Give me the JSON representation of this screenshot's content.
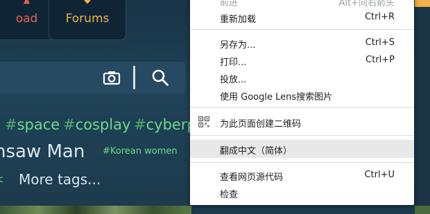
{
  "tiles": [
    {
      "label": "oad",
      "color": "#e85f57"
    },
    {
      "label": "Forums",
      "color": "#f0b04a"
    }
  ],
  "tags_row1": [
    {
      "hash": "#",
      "text": "space"
    },
    {
      "hash": "#",
      "text": "cosplay"
    },
    {
      "hash": "#",
      "text": "cyberp"
    }
  ],
  "artist_text": "nsaw Man",
  "small_tag": "#Korean women",
  "more_prefix": "c",
  "more_tags": "More tags...",
  "context_menu": {
    "items": [
      {
        "label": "前进",
        "shortcut": "Alt+向右箭头"
      },
      {
        "label": "重新加载",
        "shortcut": "Ctrl+R"
      },
      {
        "label": "另存为...",
        "shortcut": "Ctrl+S"
      },
      {
        "label": "打印...",
        "shortcut": "Ctrl+P"
      },
      {
        "label": "投放...",
        "shortcut": ""
      },
      {
        "label": "使用 Google Lens搜索图片",
        "shortcut": ""
      },
      {
        "label": "为此页面创建二维码",
        "shortcut": ""
      },
      {
        "label": "翻成中文（简体）",
        "shortcut": ""
      },
      {
        "label": "查看网页源代码",
        "shortcut": "Ctrl+U"
      },
      {
        "label": "检查",
        "shortcut": ""
      }
    ]
  },
  "colors": {
    "accent_orange": "#f0b04a",
    "accent_red": "#e85f57",
    "tag_green": "#6fd98c",
    "menu_highlight": "#e8e8e8"
  },
  "icons": [
    "camera-icon",
    "search-icon",
    "qr-code-icon"
  ]
}
